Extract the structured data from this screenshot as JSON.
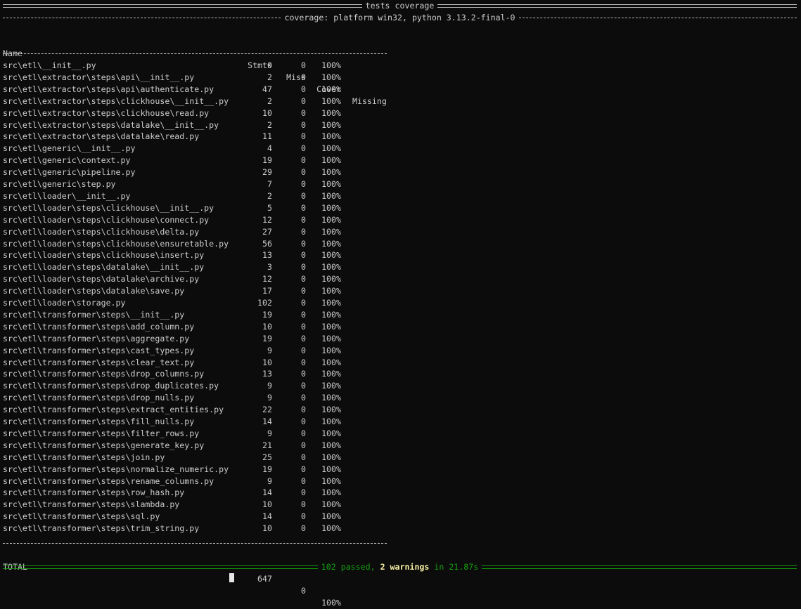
{
  "header": {
    "session_title": "tests coverage",
    "platform_line": "coverage: platform win32, python 3.13.2-final-0"
  },
  "table": {
    "columns": {
      "name": "Name",
      "stmts": "Stmts",
      "miss": "Miss",
      "cover": "Cover",
      "missing": "Missing"
    },
    "rows": [
      {
        "name": "src\\etl\\__init__.py",
        "stmts": "0",
        "miss": "0",
        "cover": "100%"
      },
      {
        "name": "src\\etl\\extractor\\steps\\api\\__init__.py",
        "stmts": "2",
        "miss": "0",
        "cover": "100%"
      },
      {
        "name": "src\\etl\\extractor\\steps\\api\\authenticate.py",
        "stmts": "47",
        "miss": "0",
        "cover": "100%"
      },
      {
        "name": "src\\etl\\extractor\\steps\\clickhouse\\__init__.py",
        "stmts": "2",
        "miss": "0",
        "cover": "100%"
      },
      {
        "name": "src\\etl\\extractor\\steps\\clickhouse\\read.py",
        "stmts": "10",
        "miss": "0",
        "cover": "100%"
      },
      {
        "name": "src\\etl\\extractor\\steps\\datalake\\__init__.py",
        "stmts": "2",
        "miss": "0",
        "cover": "100%"
      },
      {
        "name": "src\\etl\\extractor\\steps\\datalake\\read.py",
        "stmts": "11",
        "miss": "0",
        "cover": "100%"
      },
      {
        "name": "src\\etl\\generic\\__init__.py",
        "stmts": "4",
        "miss": "0",
        "cover": "100%"
      },
      {
        "name": "src\\etl\\generic\\context.py",
        "stmts": "19",
        "miss": "0",
        "cover": "100%"
      },
      {
        "name": "src\\etl\\generic\\pipeline.py",
        "stmts": "29",
        "miss": "0",
        "cover": "100%"
      },
      {
        "name": "src\\etl\\generic\\step.py",
        "stmts": "7",
        "miss": "0",
        "cover": "100%"
      },
      {
        "name": "src\\etl\\loader\\__init__.py",
        "stmts": "2",
        "miss": "0",
        "cover": "100%"
      },
      {
        "name": "src\\etl\\loader\\steps\\clickhouse\\__init__.py",
        "stmts": "5",
        "miss": "0",
        "cover": "100%"
      },
      {
        "name": "src\\etl\\loader\\steps\\clickhouse\\connect.py",
        "stmts": "12",
        "miss": "0",
        "cover": "100%"
      },
      {
        "name": "src\\etl\\loader\\steps\\clickhouse\\delta.py",
        "stmts": "27",
        "miss": "0",
        "cover": "100%"
      },
      {
        "name": "src\\etl\\loader\\steps\\clickhouse\\ensuretable.py",
        "stmts": "56",
        "miss": "0",
        "cover": "100%"
      },
      {
        "name": "src\\etl\\loader\\steps\\clickhouse\\insert.py",
        "stmts": "13",
        "miss": "0",
        "cover": "100%"
      },
      {
        "name": "src\\etl\\loader\\steps\\datalake\\__init__.py",
        "stmts": "3",
        "miss": "0",
        "cover": "100%"
      },
      {
        "name": "src\\etl\\loader\\steps\\datalake\\archive.py",
        "stmts": "12",
        "miss": "0",
        "cover": "100%"
      },
      {
        "name": "src\\etl\\loader\\steps\\datalake\\save.py",
        "stmts": "17",
        "miss": "0",
        "cover": "100%"
      },
      {
        "name": "src\\etl\\loader\\storage.py",
        "stmts": "102",
        "miss": "0",
        "cover": "100%"
      },
      {
        "name": "src\\etl\\transformer\\steps\\__init__.py",
        "stmts": "19",
        "miss": "0",
        "cover": "100%"
      },
      {
        "name": "src\\etl\\transformer\\steps\\add_column.py",
        "stmts": "10",
        "miss": "0",
        "cover": "100%"
      },
      {
        "name": "src\\etl\\transformer\\steps\\aggregate.py",
        "stmts": "19",
        "miss": "0",
        "cover": "100%"
      },
      {
        "name": "src\\etl\\transformer\\steps\\cast_types.py",
        "stmts": "9",
        "miss": "0",
        "cover": "100%"
      },
      {
        "name": "src\\etl\\transformer\\steps\\clear_text.py",
        "stmts": "10",
        "miss": "0",
        "cover": "100%"
      },
      {
        "name": "src\\etl\\transformer\\steps\\drop_columns.py",
        "stmts": "13",
        "miss": "0",
        "cover": "100%"
      },
      {
        "name": "src\\etl\\transformer\\steps\\drop_duplicates.py",
        "stmts": "9",
        "miss": "0",
        "cover": "100%"
      },
      {
        "name": "src\\etl\\transformer\\steps\\drop_nulls.py",
        "stmts": "9",
        "miss": "0",
        "cover": "100%"
      },
      {
        "name": "src\\etl\\transformer\\steps\\extract_entities.py",
        "stmts": "22",
        "miss": "0",
        "cover": "100%"
      },
      {
        "name": "src\\etl\\transformer\\steps\\fill_nulls.py",
        "stmts": "14",
        "miss": "0",
        "cover": "100%"
      },
      {
        "name": "src\\etl\\transformer\\steps\\filter_rows.py",
        "stmts": "9",
        "miss": "0",
        "cover": "100%"
      },
      {
        "name": "src\\etl\\transformer\\steps\\generate_key.py",
        "stmts": "21",
        "miss": "0",
        "cover": "100%"
      },
      {
        "name": "src\\etl\\transformer\\steps\\join.py",
        "stmts": "25",
        "miss": "0",
        "cover": "100%"
      },
      {
        "name": "src\\etl\\transformer\\steps\\normalize_numeric.py",
        "stmts": "19",
        "miss": "0",
        "cover": "100%"
      },
      {
        "name": "src\\etl\\transformer\\steps\\rename_columns.py",
        "stmts": "9",
        "miss": "0",
        "cover": "100%"
      },
      {
        "name": "src\\etl\\transformer\\steps\\row_hash.py",
        "stmts": "14",
        "miss": "0",
        "cover": "100%"
      },
      {
        "name": "src\\etl\\transformer\\steps\\slambda.py",
        "stmts": "10",
        "miss": "0",
        "cover": "100%"
      },
      {
        "name": "src\\etl\\transformer\\steps\\sql.py",
        "stmts": "14",
        "miss": "0",
        "cover": "100%"
      },
      {
        "name": "src\\etl\\transformer\\steps\\trim_string.py",
        "stmts": "10",
        "miss": "0",
        "cover": "100%"
      }
    ],
    "total": {
      "name": "TOTAL",
      "stmts": "647",
      "miss": "0",
      "cover": "100%"
    }
  },
  "summary": {
    "passed": "102 passed",
    "separator": ",",
    "warnings": "2 warnings",
    "duration": "in 21.87s"
  },
  "colors": {
    "background": "#0c0c0c",
    "text": "#cccccc",
    "passed": "#13a10e",
    "warnings": "#f9f1a5"
  }
}
